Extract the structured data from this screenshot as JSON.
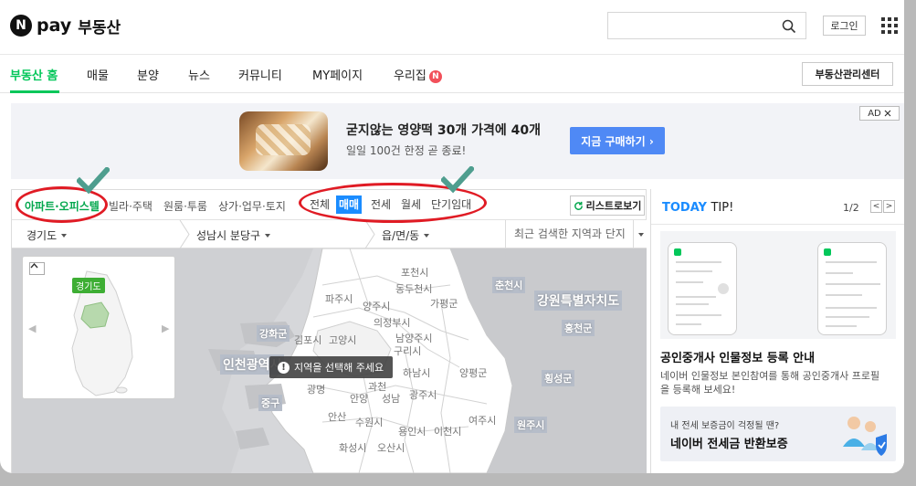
{
  "header": {
    "logo_n": "N",
    "logo_pay": "pay",
    "service": "부동산",
    "search_placeholder": "",
    "login": "로그인"
  },
  "nav": {
    "items": [
      {
        "label": "부동산 홈",
        "active": true
      },
      {
        "label": "매물"
      },
      {
        "label": "분양"
      },
      {
        "label": "뉴스"
      },
      {
        "label": "커뮤니티"
      },
      {
        "label": "MY페이지"
      },
      {
        "label": "우리집",
        "badge": "N"
      }
    ],
    "manage": "부동산관리센터"
  },
  "ad": {
    "headline": "굳지않는 영양떡 30개 가격에 40개",
    "sub": "일일 100건 한정 곧 종료!",
    "cta": "지금 구매하기 ›",
    "badge": "AD"
  },
  "filter": {
    "property_types": [
      "아파트·오피스텔",
      "빌라·주택",
      "원룸·투룸",
      "상가·업무·토지"
    ],
    "trade_types": [
      "전체",
      "매매",
      "전세",
      "월세",
      "단기임대"
    ],
    "list_button": "리스트로보기"
  },
  "region": {
    "province": "경기도",
    "city": "성남시 분당구",
    "dong": "읍/면/동",
    "recent": "최근 검색한 지역과 단지"
  },
  "map": {
    "mini_tag": "경기도",
    "toast": "지역을 선택해 주세요",
    "labels": {
      "pocheon": "포천시",
      "chuncheon": "춘천시",
      "dongducheon": "동두천시",
      "gangwon": "강원특별자치도",
      "paju": "파주시",
      "yangju": "양주시",
      "gapyeong": "가평군",
      "uijeongbu": "의정부시",
      "hongcheon": "홍천군",
      "ganghwa": "강화군",
      "gimpo": "김포시",
      "goyang": "고양시",
      "namyangju": "남양주시",
      "guri": "구리시",
      "incheon": "인천광역시",
      "hanam": "하남시",
      "yangpyeong": "양평군",
      "hoengseong": "횡성군",
      "junggu": "중구",
      "gwangmyeong": "광명",
      "gwacheon": "과천",
      "anyang": "안양",
      "seongnam": "성남",
      "gwangju": "광주시",
      "ansan": "안산",
      "suwon": "수원시",
      "yongin": "용인시",
      "icheon": "이천시",
      "yeoju": "여주시",
      "wonju": "원주시",
      "hwaseong": "화성시",
      "osan": "오산시"
    }
  },
  "tip": {
    "today": "TODAY",
    "tip": "TIP!",
    "pager": "1/2",
    "heading": "공인중개사 인물정보 등록 안내",
    "desc1": "네이버 인물정보 본인참여를 통해 공인중개사 프로필",
    "desc2": "을 등록해 보세요!",
    "banner_sub": "내 전세 보증금이 걱정될 땐?",
    "banner_main": "네이버 전세금 반환보증"
  },
  "colors": {
    "brand_green": "#03c75a",
    "accent_blue": "#1a8cff",
    "annotation_red": "#e01b24",
    "check_teal": "#4f9e8f"
  }
}
